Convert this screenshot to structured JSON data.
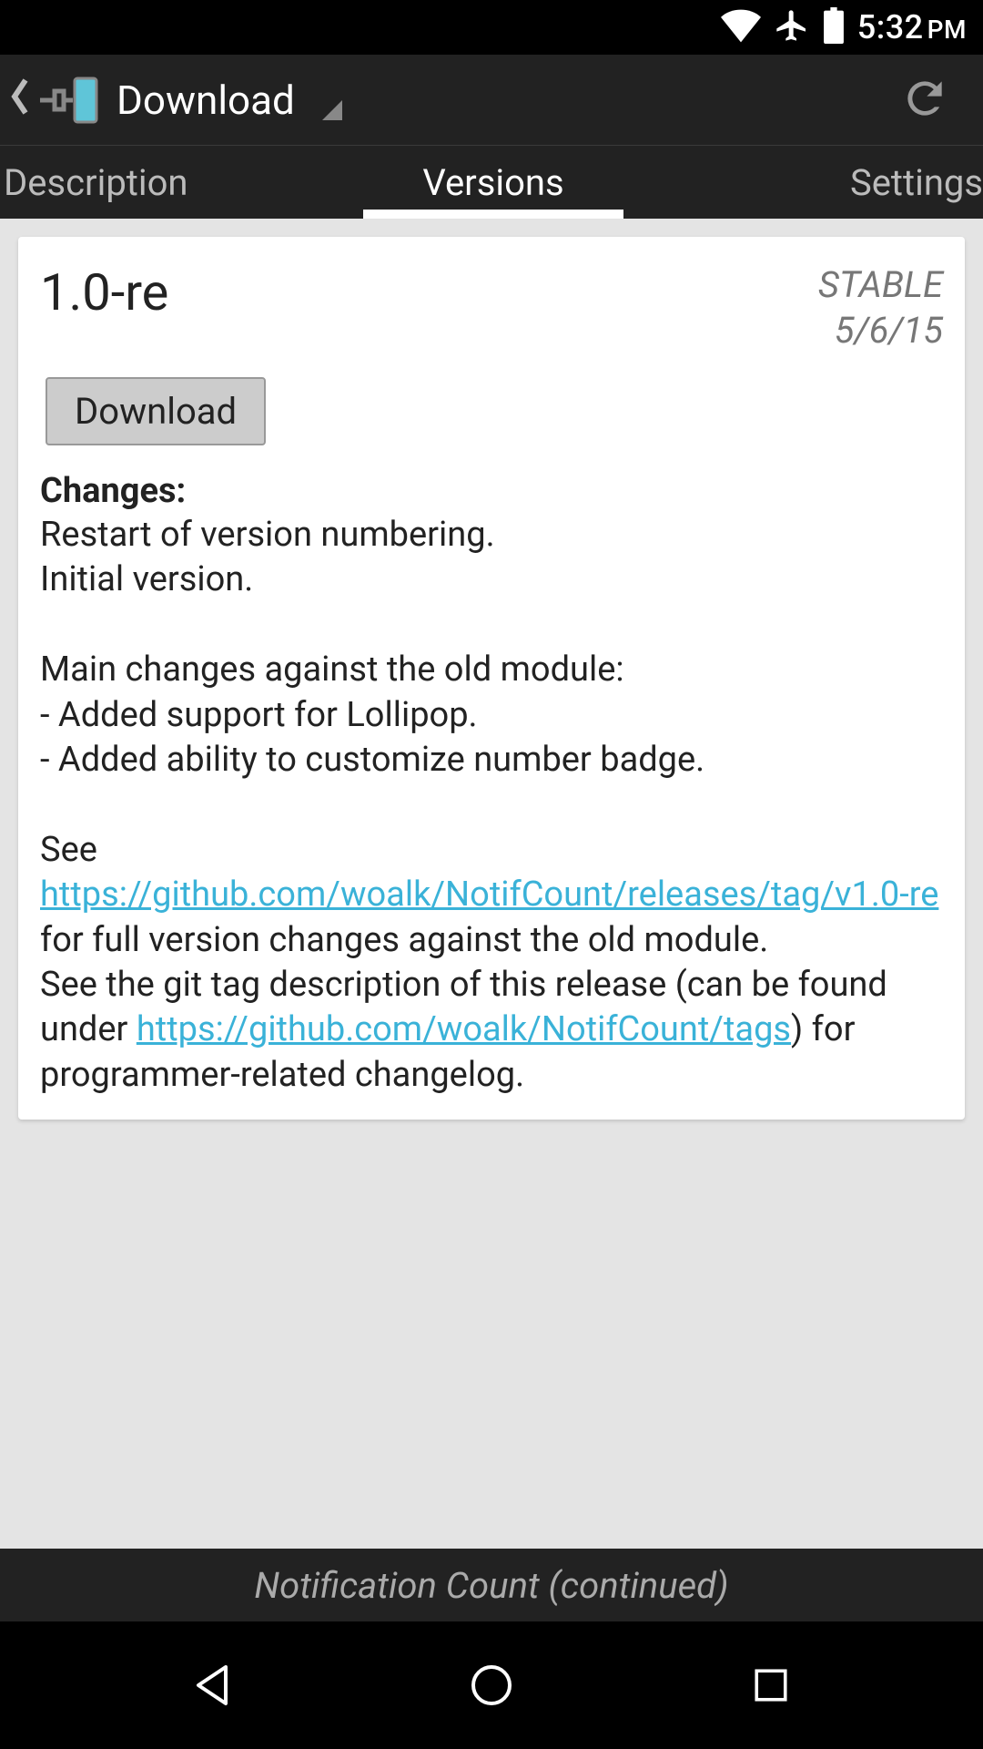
{
  "status": {
    "time": "5:32",
    "ampm": "PM"
  },
  "actionbar": {
    "title": "Download"
  },
  "tabs": {
    "items": [
      "Description",
      "Versions",
      "Settings"
    ],
    "active_index": 1
  },
  "card": {
    "version": "1.0-re",
    "channel": "STABLE",
    "date": "5/6/15",
    "download_btn": "Download",
    "changes_label": "Changes:",
    "body_line1": "Restart of version numbering.",
    "body_line2": "Initial version.",
    "body_line3": "Main changes against the old module:",
    "body_line4": "- Added support for Lollipop.",
    "body_line5": "- Added ability to customize number badge.",
    "body_see": "See ",
    "link1": "https://github.com/woalk/NotifCount/releases/tag/v1.0-re",
    "body_after_link1": " for full version changes against the old module.",
    "body_line_git": "See the git tag description of this release (can be found under ",
    "link2": "https://github.com/woalk/NotifCount/tags",
    "body_after_link2": ") for programmer-related changelog."
  },
  "footer_label": "Notification Count (continued)"
}
